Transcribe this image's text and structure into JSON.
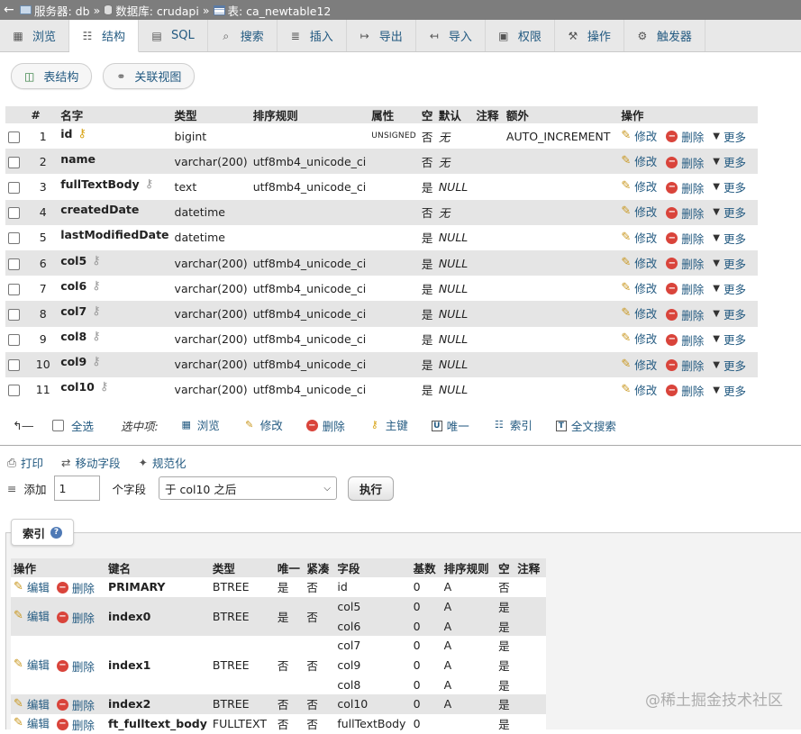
{
  "breadcrumb": {
    "back": "←",
    "server": "服务器: db",
    "database": "数据库: crudapi",
    "table": "表: ca_newtable12",
    "separator": "»"
  },
  "tabs": [
    {
      "label": "浏览",
      "icon": "table-icon"
    },
    {
      "label": "结构",
      "icon": "structure-icon"
    },
    {
      "label": "SQL",
      "icon": "sql-icon"
    },
    {
      "label": "搜索",
      "icon": "search-icon"
    },
    {
      "label": "插入",
      "icon": "insert-icon"
    },
    {
      "label": "导出",
      "icon": "export-icon"
    },
    {
      "label": "导入",
      "icon": "import-icon"
    },
    {
      "label": "权限",
      "icon": "privileges-icon"
    },
    {
      "label": "操作",
      "icon": "wrench-icon"
    },
    {
      "label": "触发器",
      "icon": "triggers-icon"
    }
  ],
  "subtabs": [
    {
      "label": "表结构"
    },
    {
      "label": "关联视图"
    }
  ],
  "columns_header": [
    "#",
    "名字",
    "类型",
    "排序规则",
    "属性",
    "空",
    "默认",
    "注释",
    "额外",
    "操作"
  ],
  "row_actions": {
    "edit": "修改",
    "drop": "删除",
    "more": "更多"
  },
  "columns": [
    {
      "num": "1",
      "name": "id",
      "key": "primary",
      "type": "bigint",
      "collation": "",
      "attributes": "UNSIGNED",
      "null": "否",
      "default": "无",
      "comment": "",
      "extra": "AUTO_INCREMENT"
    },
    {
      "num": "2",
      "name": "name",
      "key": "",
      "type": "varchar(200)",
      "collation": "utf8mb4_unicode_ci",
      "attributes": "",
      "null": "否",
      "default": "无",
      "comment": "",
      "extra": ""
    },
    {
      "num": "3",
      "name": "fullTextBody",
      "key": "fulltext",
      "type": "text",
      "collation": "utf8mb4_unicode_ci",
      "attributes": "",
      "null": "是",
      "default": "NULL",
      "comment": "",
      "extra": ""
    },
    {
      "num": "4",
      "name": "createdDate",
      "key": "",
      "type": "datetime",
      "collation": "",
      "attributes": "",
      "null": "否",
      "default": "无",
      "comment": "",
      "extra": ""
    },
    {
      "num": "5",
      "name": "lastModifiedDate",
      "key": "",
      "type": "datetime",
      "collation": "",
      "attributes": "",
      "null": "是",
      "default": "NULL",
      "comment": "",
      "extra": ""
    },
    {
      "num": "6",
      "name": "col5",
      "key": "index",
      "type": "varchar(200)",
      "collation": "utf8mb4_unicode_ci",
      "attributes": "",
      "null": "是",
      "default": "NULL",
      "comment": "",
      "extra": ""
    },
    {
      "num": "7",
      "name": "col6",
      "key": "index",
      "type": "varchar(200)",
      "collation": "utf8mb4_unicode_ci",
      "attributes": "",
      "null": "是",
      "default": "NULL",
      "comment": "",
      "extra": ""
    },
    {
      "num": "8",
      "name": "col7",
      "key": "index",
      "type": "varchar(200)",
      "collation": "utf8mb4_unicode_ci",
      "attributes": "",
      "null": "是",
      "default": "NULL",
      "comment": "",
      "extra": ""
    },
    {
      "num": "9",
      "name": "col8",
      "key": "index",
      "type": "varchar(200)",
      "collation": "utf8mb4_unicode_ci",
      "attributes": "",
      "null": "是",
      "default": "NULL",
      "comment": "",
      "extra": ""
    },
    {
      "num": "10",
      "name": "col9",
      "key": "index",
      "type": "varchar(200)",
      "collation": "utf8mb4_unicode_ci",
      "attributes": "",
      "null": "是",
      "default": "NULL",
      "comment": "",
      "extra": ""
    },
    {
      "num": "11",
      "name": "col10",
      "key": "index",
      "type": "varchar(200)",
      "collation": "utf8mb4_unicode_ci",
      "attributes": "",
      "null": "是",
      "default": "NULL",
      "comment": "",
      "extra": ""
    }
  ],
  "bulk": {
    "check_all": "全选",
    "with_selected": "选中项:",
    "actions": [
      {
        "label": "浏览",
        "icon": "table-icon"
      },
      {
        "label": "修改",
        "icon": "pencil-icon"
      },
      {
        "label": "删除",
        "icon": "drop-icon"
      },
      {
        "label": "主键",
        "icon": "key-icon"
      },
      {
        "label": "唯一",
        "icon": "unique-icon"
      },
      {
        "label": "索引",
        "icon": "index-icon"
      },
      {
        "label": "全文搜索",
        "icon": "fulltext-icon"
      }
    ]
  },
  "tools": [
    {
      "label": "打印",
      "icon": "print-icon"
    },
    {
      "label": "移动字段",
      "icon": "move-columns-icon"
    },
    {
      "label": "规范化",
      "icon": "normalize-icon"
    }
  ],
  "add_fields": {
    "label": "添加",
    "count": "1",
    "unit": "个字段",
    "position": "于 col10 之后",
    "execute": "执行"
  },
  "indexes": {
    "title": "索引",
    "header": [
      "操作",
      "键名",
      "类型",
      "唯一",
      "紧凑",
      "字段",
      "基数",
      "排序规则",
      "空",
      "注释"
    ],
    "edit": "编辑",
    "drop": "删除",
    "rows": [
      {
        "name": "PRIMARY",
        "type": "BTREE",
        "unique": "是",
        "packed": "否",
        "cols": [
          {
            "col": "id",
            "card": "0",
            "coll": "A",
            "null": "否"
          }
        ]
      },
      {
        "name": "index0",
        "type": "BTREE",
        "unique": "是",
        "packed": "否",
        "cols": [
          {
            "col": "col5",
            "card": "0",
            "coll": "A",
            "null": "是"
          },
          {
            "col": "col6",
            "card": "0",
            "coll": "A",
            "null": "是"
          }
        ]
      },
      {
        "name": "index1",
        "type": "BTREE",
        "unique": "否",
        "packed": "否",
        "cols": [
          {
            "col": "col7",
            "card": "0",
            "coll": "A",
            "null": "是"
          },
          {
            "col": "col9",
            "card": "0",
            "coll": "A",
            "null": "是"
          },
          {
            "col": "col8",
            "card": "0",
            "coll": "A",
            "null": "是"
          }
        ]
      },
      {
        "name": "index2",
        "type": "BTREE",
        "unique": "否",
        "packed": "否",
        "cols": [
          {
            "col": "col10",
            "card": "0",
            "coll": "A",
            "null": "是"
          }
        ]
      },
      {
        "name": "ft_fulltext_body",
        "type": "FULLTEXT",
        "unique": "否",
        "packed": "否",
        "cols": [
          {
            "col": "fullTextBody",
            "card": "0",
            "coll": "",
            "null": "是"
          }
        ]
      }
    ]
  },
  "watermark": "@稀土掘金技术社区",
  "colors": {
    "link": "#235a81",
    "header_bg": "#e5e5e5",
    "topbar": "#7d7d7d",
    "drop": "#d9443b",
    "pencil": "#c8961c"
  }
}
